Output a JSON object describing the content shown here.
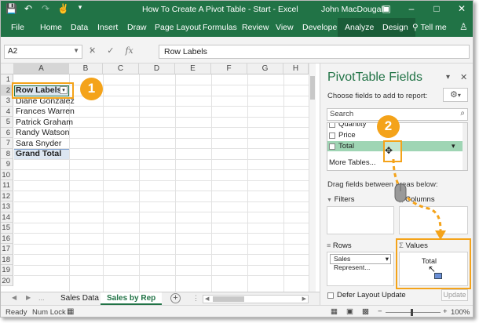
{
  "window": {
    "title": "How To Create A Pivot Table - Start  -  Excel",
    "user": "John MacDougall",
    "accent_color": "#217346",
    "highlight_color": "#f4a31a"
  },
  "qat": {
    "icons": [
      "save-icon",
      "undo-icon",
      "redo-icon",
      "touch-mode-icon",
      "customize-qat-icon"
    ]
  },
  "window_controls": {
    "ribbon_display": "▣",
    "minimize": "–",
    "maximize": "□",
    "close": "✕"
  },
  "ribbon": {
    "tabs": [
      "File",
      "Home",
      "Data",
      "Insert",
      "Draw",
      "Page Layout",
      "Formulas",
      "Review",
      "View",
      "Developer",
      "Analyze",
      "Design"
    ],
    "tell_me": "Tell me",
    "person_icon": "♙"
  },
  "formula_bar": {
    "name_box": "A2",
    "name_box_dropdown": "▼",
    "content": "Row Labels",
    "cancel_icon": "✕",
    "enter_icon": "✓",
    "fx": "fx"
  },
  "grid": {
    "columns": [
      "A",
      "B",
      "C",
      "D",
      "E",
      "F",
      "G",
      "H"
    ],
    "rows": [
      "1",
      "2",
      "3",
      "4",
      "5",
      "6",
      "7",
      "8",
      "9",
      "10",
      "11",
      "12",
      "13",
      "14",
      "15",
      "16",
      "17",
      "18",
      "19",
      "20"
    ],
    "cells": {
      "a2": "Row Labels",
      "a3": "Diane Gonzalez",
      "a4": "Frances Warren",
      "a5": "Patrick Graham",
      "a6": "Randy Watson",
      "a7": "Sara Snyder",
      "a8": "Grand Total"
    },
    "filter_button": "▾"
  },
  "sheets": {
    "nav_prev": "◀",
    "nav_next": "▶",
    "ellipsis": "...",
    "tabs": [
      "Sales Data",
      "Sales by Rep"
    ],
    "active": "Sales by Rep",
    "add": "+"
  },
  "status": {
    "ready": "Ready",
    "num_lock": "Num Lock",
    "zoom": "100%",
    "zoom_minus": "−",
    "zoom_plus": "+"
  },
  "pivot_pane": {
    "title": "PivotTable Fields",
    "subtitle": "Choose fields to add to report:",
    "close": "✕",
    "collapse": "▾",
    "settings_icon": "⚙",
    "settings_dropdown": "▾",
    "search_placeholder": "Search",
    "search_icon": "⌕",
    "fields": [
      {
        "name": "Quantity",
        "checked": false
      },
      {
        "name": "Price",
        "checked": false
      },
      {
        "name": "Total",
        "checked": false
      }
    ],
    "more_tables": "More Tables...",
    "drag_hint": "Drag fields between areas below:",
    "areas": {
      "filters": "Filters",
      "columns": "Columns",
      "rows": "Rows",
      "values": "Values"
    },
    "rows_chip": "Sales Represent...",
    "rows_chip_dropdown": "▾",
    "values_dragged": "Total",
    "defer_update": "Defer Layout Update",
    "update_button": "Update"
  },
  "callouts": [
    "1",
    "2"
  ],
  "glyphs": {
    "filter_icon": "▼",
    "columns_icon": "|||",
    "rows_icon": "≡",
    "sigma_icon": "Σ",
    "move_cursor": "✥",
    "arrow_cursor": "↖",
    "dropdown": "▾"
  }
}
